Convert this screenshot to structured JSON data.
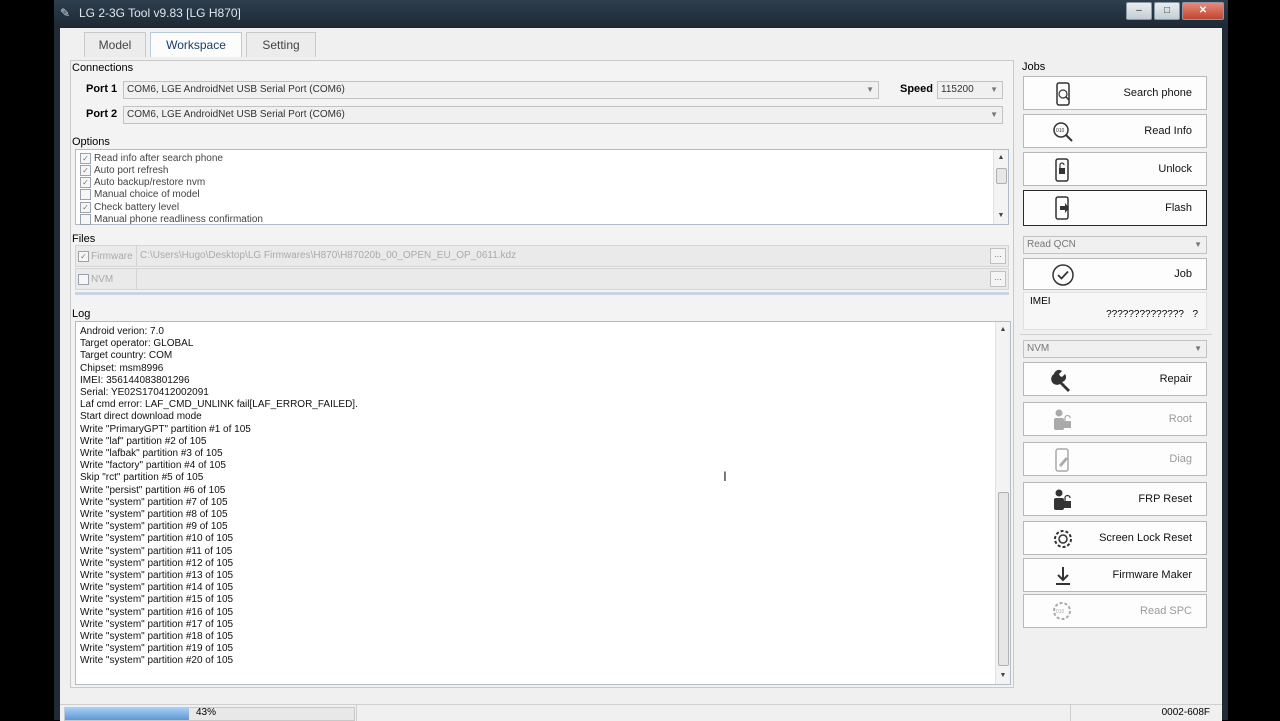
{
  "window": {
    "title": "LG 2-3G Tool v9.83 [LG H870]"
  },
  "tabs": [
    "Model",
    "Workspace",
    "Setting"
  ],
  "connections": {
    "label": "Connections",
    "port1_label": "Port 1",
    "port1_value": "COM6, LGE AndroidNet USB Serial Port (COM6)",
    "port2_label": "Port 2",
    "port2_value": "COM6, LGE AndroidNet USB Serial Port (COM6)",
    "speed_label": "Speed",
    "speed_value": "115200"
  },
  "options": {
    "label": "Options",
    "items": [
      {
        "label": "Read info after search phone",
        "checked": true
      },
      {
        "label": "Auto port refresh",
        "checked": true
      },
      {
        "label": "Auto backup/restore nvm",
        "checked": true
      },
      {
        "label": "Manual choice of model",
        "checked": false
      },
      {
        "label": "Check battery level",
        "checked": true
      },
      {
        "label": "Manual phone readliness confirmation",
        "checked": false
      }
    ]
  },
  "files": {
    "label": "Files",
    "firmware_label": "Firmware",
    "firmware_path": "C:\\Users\\Hugo\\Desktop\\LG Firmwares\\H870\\H87020b_00_OPEN_EU_OP_0611.kdz",
    "nvm_label": "NVM",
    "browse": "..."
  },
  "log": {
    "label": "Log",
    "lines": [
      "Android verion: 7.0",
      "Target operator: GLOBAL",
      "Target country: COM",
      "Chipset: msm8996",
      "IMEI: 356144083801296",
      "Serial: YE02S170412002091",
      "Laf cmd error: LAF_CMD_UNLINK fail[LAF_ERROR_FAILED].",
      "Start direct download mode",
      "Write \"PrimaryGPT\" partition #1 of 105",
      "Write \"laf\" partition #2 of 105",
      "Write \"lafbak\" partition #3 of 105",
      "Write \"factory\" partition #4 of 105",
      "Skip \"rct\" partition #5 of 105",
      "Write \"persist\" partition #6 of 105",
      "Write \"system\" partition #7 of 105",
      "Write \"system\" partition #8 of 105",
      "Write \"system\" partition #9 of 105",
      "Write \"system\" partition #10 of 105",
      "Write \"system\" partition #11 of 105",
      "Write \"system\" partition #12 of 105",
      "Write \"system\" partition #13 of 105",
      "Write \"system\" partition #14 of 105",
      "Write \"system\" partition #15 of 105",
      "Write \"system\" partition #16 of 105",
      "Write \"system\" partition #17 of 105",
      "Write \"system\" partition #18 of 105",
      "Write \"system\" partition #19 of 105",
      "Write \"system\" partition #20 of 105"
    ]
  },
  "jobs": {
    "label": "Jobs",
    "search_phone": "Search phone",
    "read_info": "Read Info",
    "unlock": "Unlock",
    "flash": "Flash",
    "read_qcn": "Read QCN",
    "job": "Job",
    "imei_label": "IMEI",
    "imei_value": "??????????????",
    "imei_q": "?",
    "nvm": "NVM",
    "repair": "Repair",
    "root": "Root",
    "diag": "Diag",
    "frp_reset": "FRP Reset",
    "screen_lock_reset": "Screen Lock Reset",
    "firmware_maker": "Firmware Maker",
    "read_spc": "Read SPC"
  },
  "status": {
    "progress_text": "43%",
    "progress_fraction": 0.43,
    "code": "0002-608F"
  }
}
